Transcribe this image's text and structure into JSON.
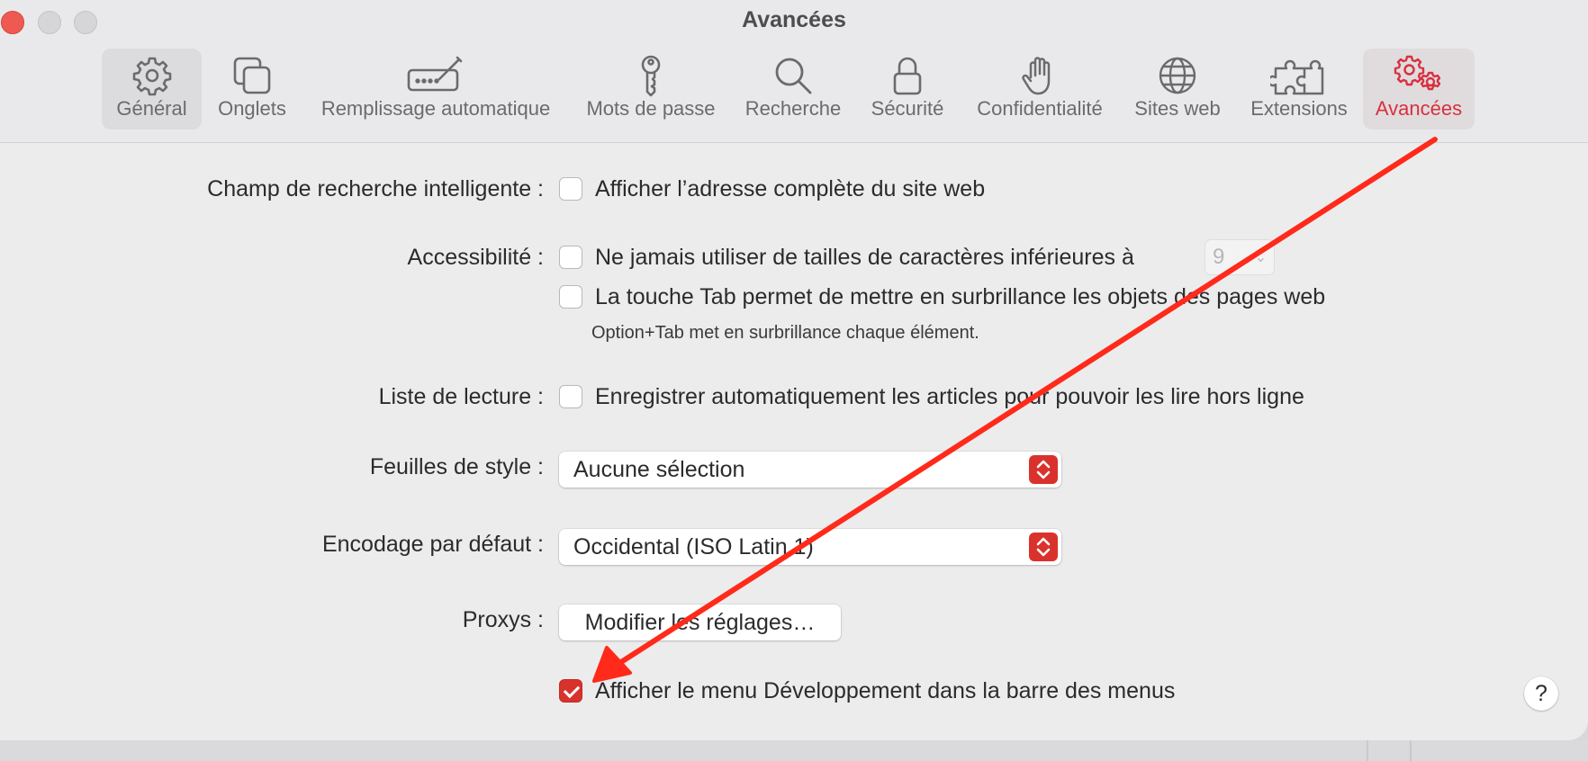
{
  "window": {
    "title": "Avancées"
  },
  "toolbar": {
    "items": [
      {
        "label": "Général",
        "icon": "gear-icon"
      },
      {
        "label": "Onglets",
        "icon": "tabs-icon"
      },
      {
        "label": "Remplissage automatique",
        "icon": "autofill-pen-icon"
      },
      {
        "label": "Mots de passe",
        "icon": "key-icon"
      },
      {
        "label": "Recherche",
        "icon": "magnifier-icon"
      },
      {
        "label": "Sécurité",
        "icon": "lock-icon"
      },
      {
        "label": "Confidentialité",
        "icon": "hand-icon"
      },
      {
        "label": "Sites web",
        "icon": "globe-icon"
      },
      {
        "label": "Extensions",
        "icon": "puzzle-icon"
      },
      {
        "label": "Avancées",
        "icon": "gears-icon"
      }
    ],
    "selected": "Général",
    "active": "Avancées",
    "accent_color": "#d8303f"
  },
  "settings": {
    "smart_search": {
      "label": "Champ de recherche intelligente :",
      "option": "Afficher l’adresse complète du site web",
      "checked": false
    },
    "accessibility": {
      "label": "Accessibilité :",
      "option1": "Ne jamais utiliser de tailles de caractères inférieures à",
      "option1_checked": false,
      "min_font_size": "9",
      "option2": "La touche Tab permet de mettre en surbrillance les objets des pages web",
      "option2_checked": false,
      "hint": "Option+Tab met en surbrillance chaque élément."
    },
    "reading_list": {
      "label": "Liste de lecture :",
      "option": "Enregistrer automatiquement les articles pour pouvoir les lire hors ligne",
      "checked": false
    },
    "stylesheet": {
      "label": "Feuilles de style :",
      "value": "Aucune sélection"
    },
    "encoding": {
      "label": "Encodage par défaut :",
      "value": "Occidental (ISO Latin 1)"
    },
    "proxies": {
      "label": "Proxys :",
      "button": "Modifier les réglages…"
    },
    "develop_menu": {
      "option": "Afficher le menu Développement dans la barre des menus",
      "checked": true
    }
  },
  "help": {
    "label": "?"
  },
  "annotation": {
    "color": "#ff2a1a"
  }
}
